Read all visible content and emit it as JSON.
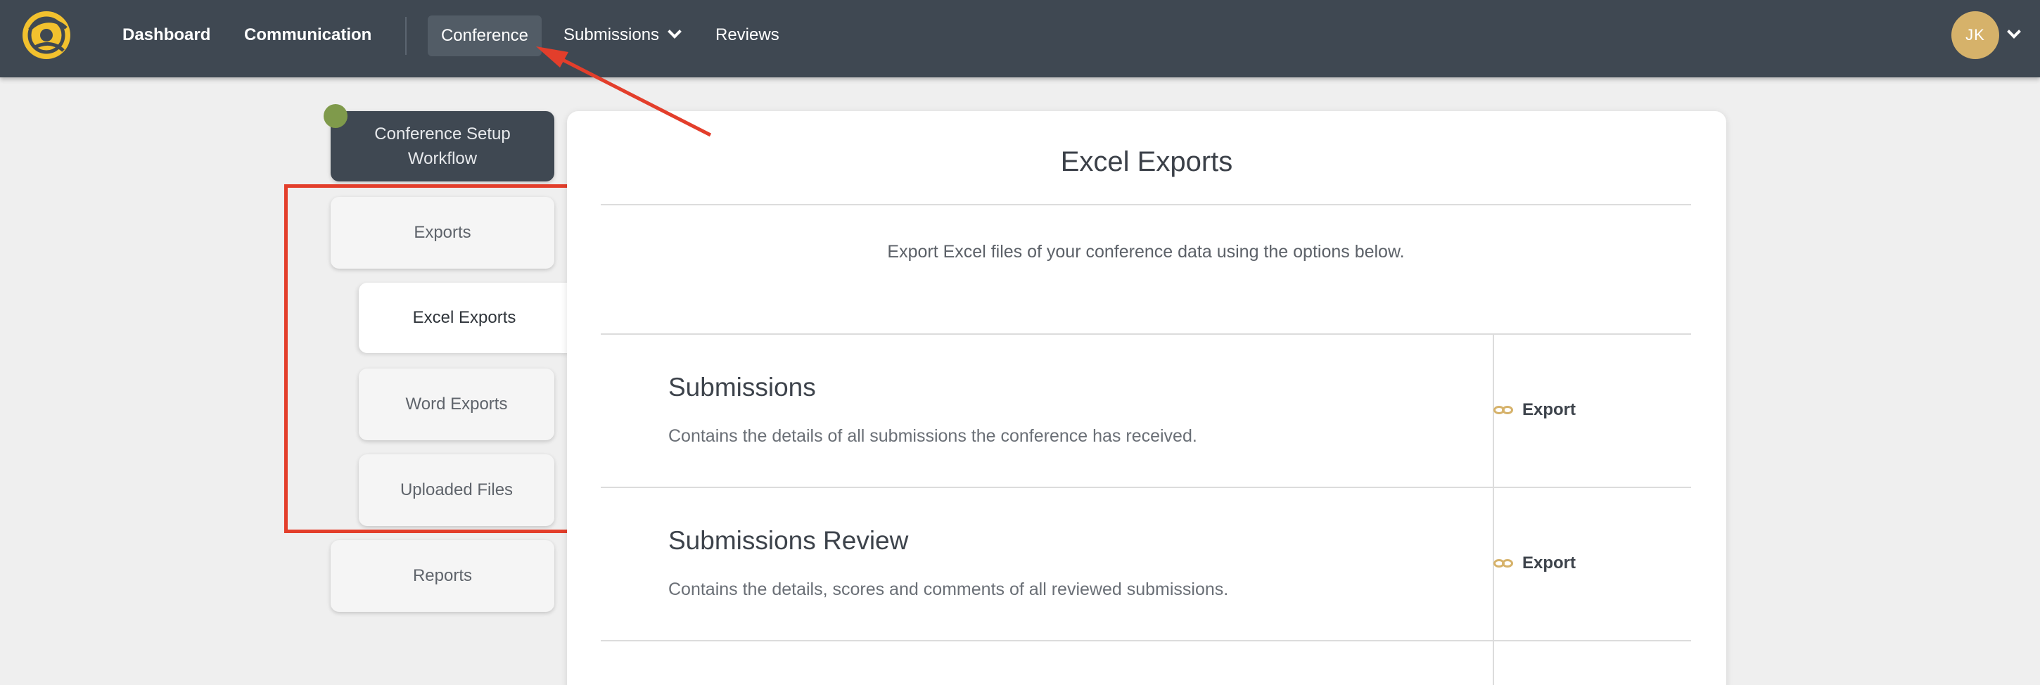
{
  "nav": {
    "dashboard": "Dashboard",
    "communication": "Communication",
    "conference": "Conference",
    "submissions": "Submissions",
    "reviews": "Reviews",
    "avatar_initials": "JK"
  },
  "sidebar": {
    "workflow_line1": "Conference Setup",
    "workflow_line2": "Workflow",
    "items": [
      {
        "label": "Exports"
      },
      {
        "label": "Excel Exports"
      },
      {
        "label": "Word Exports"
      },
      {
        "label": "Uploaded Files"
      },
      {
        "label": "Reports"
      }
    ]
  },
  "main": {
    "title": "Excel Exports",
    "intro": "Export Excel files of your conference data using the options below.",
    "sections": [
      {
        "title": "Submissions",
        "description": "Contains the details of all submissions the conference has received.",
        "action": "Export"
      },
      {
        "title": "Submissions Review",
        "description": "Contains the details, scores and comments of all reviewed submissions.",
        "action": "Export"
      }
    ]
  },
  "colors": {
    "navbar": "#3f4852",
    "accent_gold": "#d6b26a",
    "annotation_red": "#e33e2b",
    "status_green": "#7f9a4b"
  }
}
